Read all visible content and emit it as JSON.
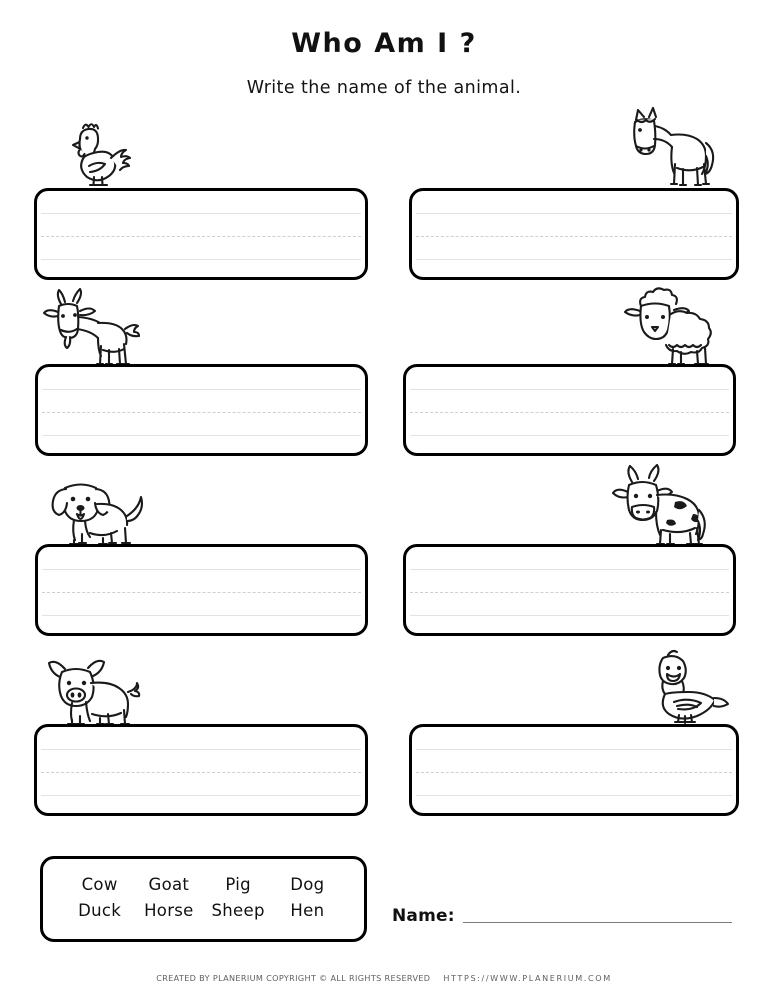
{
  "header": {
    "title": "Who Am I ?",
    "subtitle": "Write the name of the animal."
  },
  "items": [
    {
      "animal": "rooster",
      "answer_placeholder": ""
    },
    {
      "animal": "horse",
      "answer_placeholder": ""
    },
    {
      "animal": "goat",
      "answer_placeholder": ""
    },
    {
      "animal": "sheep",
      "answer_placeholder": ""
    },
    {
      "animal": "dog",
      "answer_placeholder": ""
    },
    {
      "animal": "cow",
      "answer_placeholder": ""
    },
    {
      "animal": "pig",
      "answer_placeholder": ""
    },
    {
      "animal": "duck",
      "answer_placeholder": ""
    }
  ],
  "word_bank": {
    "row1": [
      "Cow",
      "Goat",
      "Pig",
      "Dog"
    ],
    "row2": [
      "Duck",
      "Horse",
      "Sheep",
      "Hen"
    ]
  },
  "name_field": {
    "label": "Name:",
    "value": ""
  },
  "footer": {
    "credit": "CREATED BY PLANERIUM COPYRIGHT © ALL RIGHTS RESERVED",
    "url": "HTTPS://WWW.PLANERIUM.COM"
  },
  "colors": {
    "ink": "#000000",
    "paper": "#ffffff",
    "rule_solid": "#e2e2e2",
    "rule_dashed": "#cfcfcf",
    "name_line": "#7a7a7a",
    "footer_text": "#5f5f5f"
  }
}
